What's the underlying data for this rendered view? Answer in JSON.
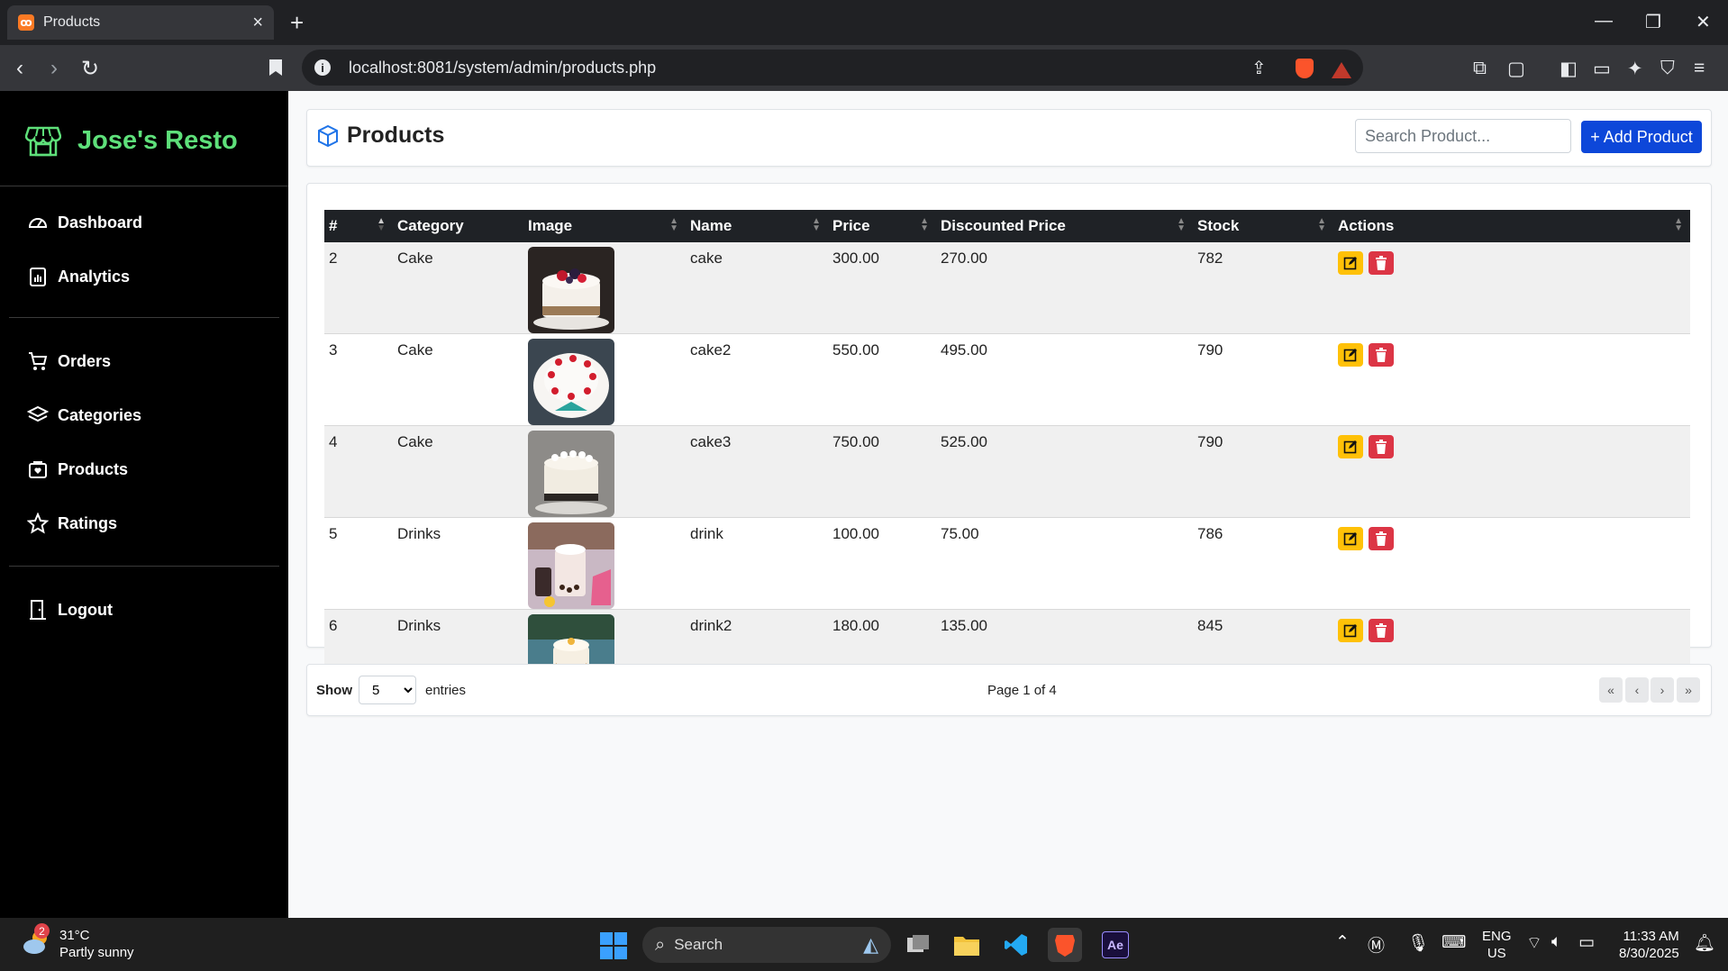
{
  "browser": {
    "tab_title": "Products",
    "tab_close": "×",
    "new_tab": "+",
    "url": "localhost:8081/system/admin/products.php",
    "info_glyph": "i"
  },
  "sidebar": {
    "brand": "Jose's Resto",
    "items": [
      {
        "label": "Dashboard",
        "icon": "gauge-icon"
      },
      {
        "label": "Analytics",
        "icon": "clipboard-chart-icon"
      },
      {
        "label": "Orders",
        "icon": "cart-icon"
      },
      {
        "label": "Categories",
        "icon": "layers-icon"
      },
      {
        "label": "Products",
        "icon": "box-heart-icon"
      },
      {
        "label": "Ratings",
        "icon": "star-icon"
      },
      {
        "label": "Logout",
        "icon": "door-icon"
      }
    ]
  },
  "header": {
    "title": "Products",
    "search_placeholder": "Search Product...",
    "add_button": "+ Add Product"
  },
  "table": {
    "columns": [
      "#",
      "Category",
      "Image",
      "Name",
      "Price",
      "Discounted Price",
      "Stock",
      "Actions"
    ],
    "rows": [
      {
        "id": "2",
        "category": "Cake",
        "image": "cake-berries",
        "name": "cake",
        "price": "300.00",
        "discounted": "270.00",
        "stock": "782"
      },
      {
        "id": "3",
        "category": "Cake",
        "image": "cake-strawberry",
        "name": "cake2",
        "price": "550.00",
        "discounted": "495.00",
        "stock": "790"
      },
      {
        "id": "4",
        "category": "Cake",
        "image": "cake-cream",
        "name": "cake3",
        "price": "750.00",
        "discounted": "525.00",
        "stock": "790"
      },
      {
        "id": "5",
        "category": "Drinks",
        "image": "drink-milktea",
        "name": "drink",
        "price": "100.00",
        "discounted": "75.00",
        "stock": "786"
      },
      {
        "id": "6",
        "category": "Drinks",
        "image": "drink-boba",
        "name": "drink2",
        "price": "180.00",
        "discounted": "135.00",
        "stock": "845"
      }
    ]
  },
  "pagination": {
    "show_label": "Show",
    "page_size": "5",
    "entries_label": "entries",
    "page_info": "Page 1 of 4",
    "first": "«",
    "prev": "‹",
    "next": "›",
    "last": "»"
  },
  "taskbar": {
    "weather_temp": "31°C",
    "weather_desc": "Partly sunny",
    "weather_badge": "2",
    "search_label": "Search",
    "lang_top": "ENG",
    "lang_bottom": "US",
    "time": "11:33 AM",
    "date": "8/30/2025",
    "ae_label": "Ae"
  },
  "colors": {
    "brand": "#5ee07a",
    "primary": "#0d47d9",
    "edit": "#ffc107",
    "delete": "#dc3545",
    "table_header": "#1f2226"
  }
}
